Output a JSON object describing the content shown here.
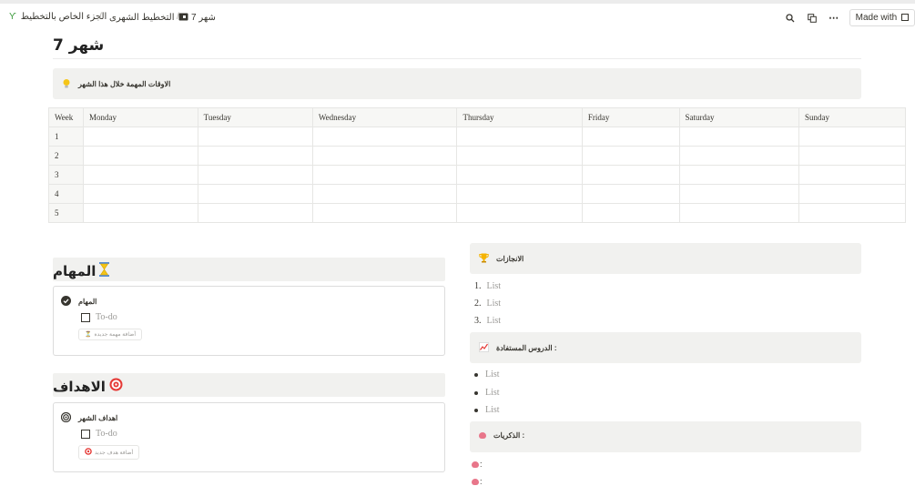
{
  "breadcrumb": {
    "root": "الجزء الخاص بالتخطيط",
    "middle": "التخطيط الشهرى",
    "current": "شهر 7",
    "separator": "/"
  },
  "toolbar": {
    "made_with": "Made with"
  },
  "page": {
    "title": "شهر 7"
  },
  "callout": {
    "text": "الاوقات المهمة خلال هذا الشهر"
  },
  "calendar": {
    "headers": [
      "Week",
      "Monday",
      "Tuesday",
      "Wednesday",
      "Thursday",
      "Friday",
      "Saturday",
      "Sunday"
    ],
    "weeks": [
      "1",
      "2",
      "3",
      "4",
      "5"
    ]
  },
  "tasks": {
    "heading": "المهام",
    "box_title": "المهام",
    "todo": "To-do",
    "add_label": "أضافة مهمة جديدة"
  },
  "goals": {
    "heading": "الاهداف",
    "box_title": "اهداف الشهر",
    "todo": "To-do",
    "add_label": "أضافة هدف جديد"
  },
  "achievements": {
    "heading": "الانجازات",
    "items": [
      {
        "num": "1.",
        "text": "List"
      },
      {
        "num": "2.",
        "text": "List"
      },
      {
        "num": "3.",
        "text": "List"
      }
    ]
  },
  "lessons": {
    "heading": ": الدروس المستفادة",
    "items": [
      "List",
      "List",
      "List"
    ]
  },
  "memories": {
    "heading": ": الذكريات",
    "items": [
      ":",
      ":"
    ]
  }
}
